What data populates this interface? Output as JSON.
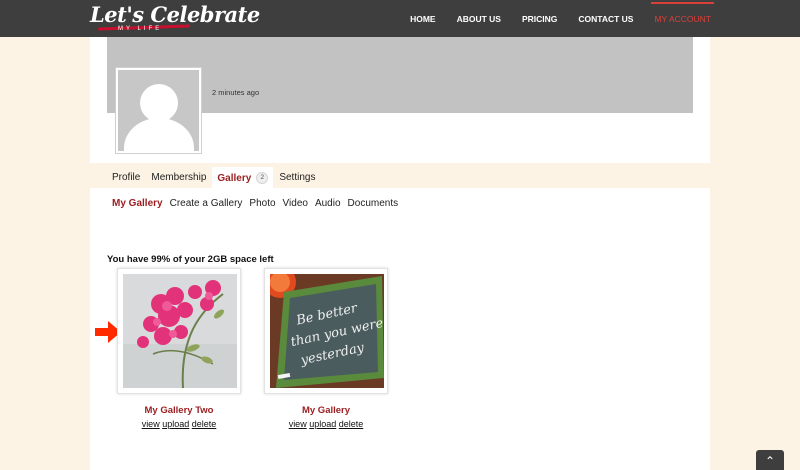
{
  "header": {
    "logo_text": "Let's Celebrate",
    "logo_subtext": "MY LIFE",
    "nav": [
      {
        "label": "HOME"
      },
      {
        "label": "ABOUT US"
      },
      {
        "label": "PRICING"
      },
      {
        "label": "CONTACT US"
      },
      {
        "label": "MY ACCOUNT"
      }
    ]
  },
  "profile": {
    "time_ago": "2 minutes ago"
  },
  "tabs": {
    "profile": "Profile",
    "membership": "Membership",
    "gallery": "Gallery",
    "gallery_count": "2",
    "settings": "Settings"
  },
  "subtabs": [
    "My Gallery",
    "Create a Gallery",
    "Photo",
    "Video",
    "Audio",
    "Documents"
  ],
  "space_note": "You have 99% of your 2GB space left",
  "galleries": [
    {
      "title": "My Gallery Two",
      "actions": [
        "view",
        "upload",
        "delete"
      ]
    },
    {
      "title": "My Gallery",
      "actions": [
        "view",
        "upload",
        "delete"
      ],
      "image_text": [
        "Be better",
        "than you were",
        "yesterday"
      ]
    }
  ],
  "colors": {
    "header_bg": "#3e3e3e",
    "accent": "#9a1d1f",
    "nav_active": "#d9403a",
    "page_bg": "#fdf3e4",
    "arrow": "#ff2a00"
  },
  "icons": {
    "arrow": "arrow-right-icon",
    "back_to_top": "chevron-up-icon"
  }
}
